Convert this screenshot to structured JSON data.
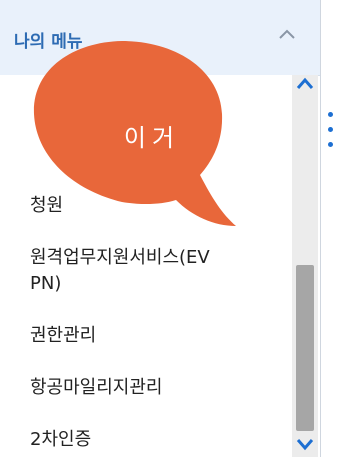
{
  "header": {
    "title": "나의 메뉴"
  },
  "menu": {
    "items": [
      {
        "label": "청원"
      },
      {
        "label": "원격업무지원서비스(EV"
      },
      {
        "label": "PN)"
      },
      {
        "label": "권한관리"
      },
      {
        "label": "항공마일리지관리"
      },
      {
        "label": "2차인증"
      }
    ]
  },
  "annotation": {
    "text": "이거"
  },
  "colors": {
    "header_bg": "#e9f1fb",
    "accent": "#2d6bb3",
    "bubble": "#e8673a",
    "scroll_arrow": "#1d6fd2"
  },
  "icons": [
    "chevron-up-icon",
    "scroll-up-arrow-icon",
    "scroll-down-arrow-icon",
    "more-vertical-icon"
  ]
}
